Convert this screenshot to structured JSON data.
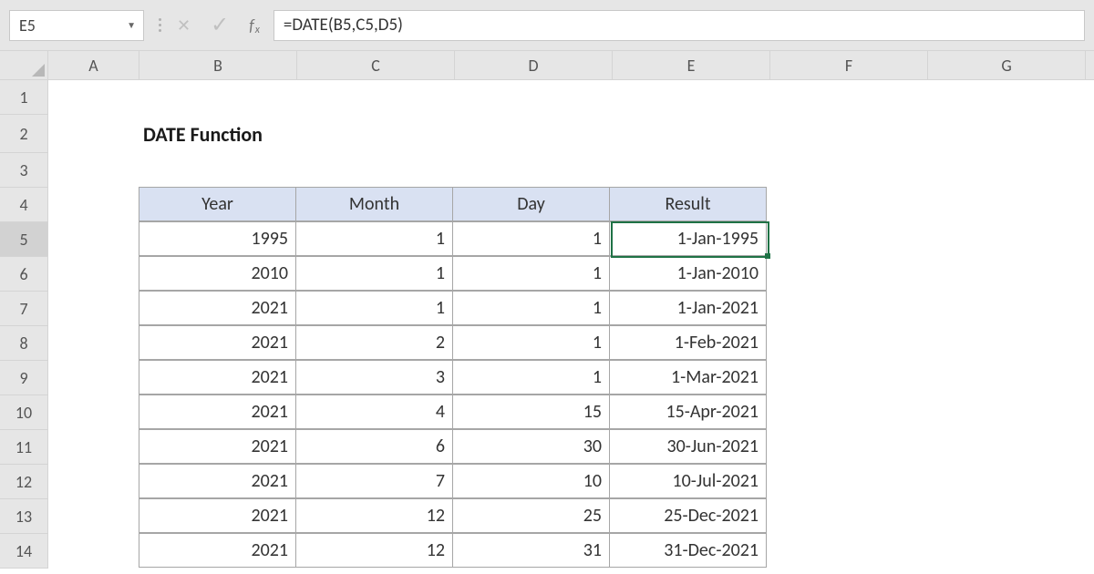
{
  "formula_bar": {
    "name_box": "E5",
    "formula": "=DATE(B5,C5,D5)"
  },
  "columns": [
    "A",
    "B",
    "C",
    "D",
    "E",
    "F",
    "G"
  ],
  "row_labels": [
    "1",
    "2",
    "3",
    "4",
    "5",
    "6",
    "7",
    "8",
    "9",
    "10",
    "11",
    "12",
    "13",
    "14"
  ],
  "title": "DATE Function",
  "selected_row_header": "5",
  "headers": {
    "year": "Year",
    "month": "Month",
    "day": "Day",
    "result": "Result"
  },
  "rows": [
    {
      "year": "1995",
      "month": "1",
      "day": "1",
      "result": "1-Jan-1995"
    },
    {
      "year": "2010",
      "month": "1",
      "day": "1",
      "result": "1-Jan-2010"
    },
    {
      "year": "2021",
      "month": "1",
      "day": "1",
      "result": "1-Jan-2021"
    },
    {
      "year": "2021",
      "month": "2",
      "day": "1",
      "result": "1-Feb-2021"
    },
    {
      "year": "2021",
      "month": "3",
      "day": "1",
      "result": "1-Mar-2021"
    },
    {
      "year": "2021",
      "month": "4",
      "day": "15",
      "result": "15-Apr-2021"
    },
    {
      "year": "2021",
      "month": "6",
      "day": "30",
      "result": "30-Jun-2021"
    },
    {
      "year": "2021",
      "month": "7",
      "day": "10",
      "result": "10-Jul-2021"
    },
    {
      "year": "2021",
      "month": "12",
      "day": "25",
      "result": "25-Dec-2021"
    },
    {
      "year": "2021",
      "month": "12",
      "day": "31",
      "result": "31-Dec-2021"
    }
  ]
}
